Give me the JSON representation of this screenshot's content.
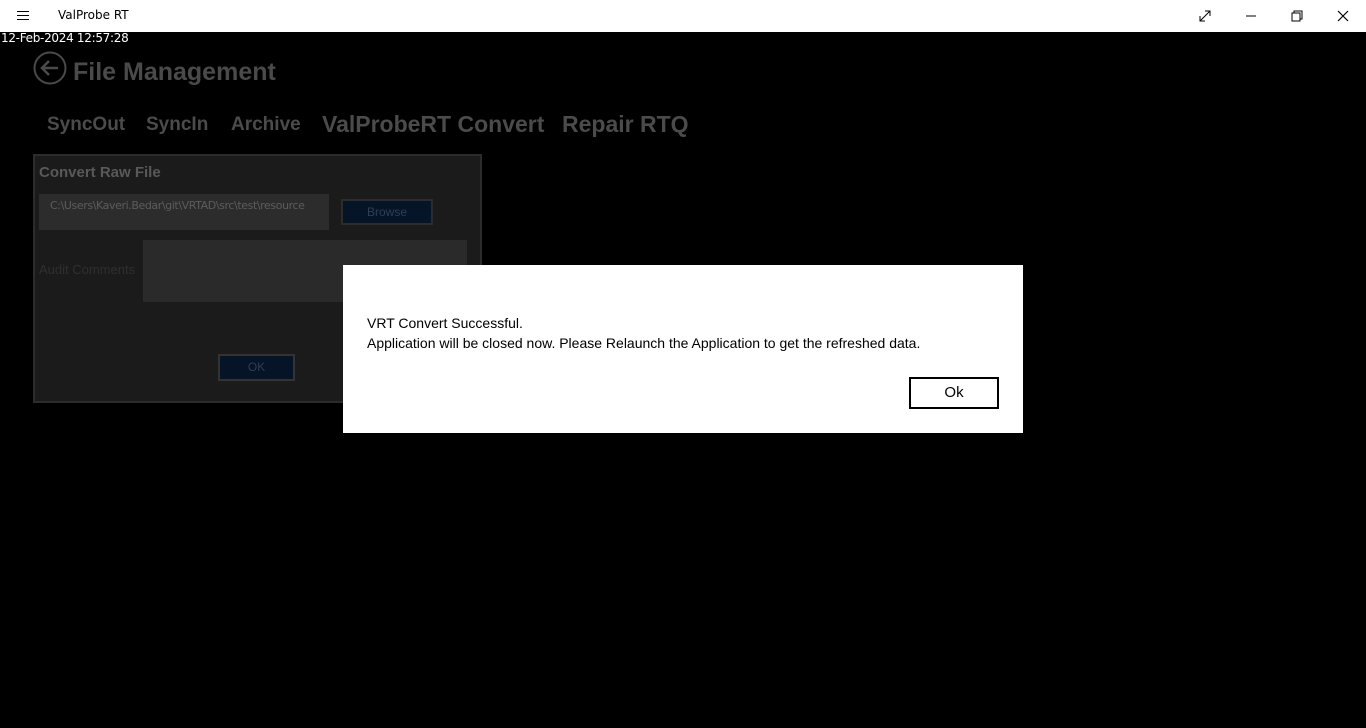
{
  "window": {
    "title": "ValProbe RT",
    "controls": [
      "expand-icon",
      "minimize-icon",
      "restore-icon",
      "close-icon"
    ]
  },
  "timestamp": "12-Feb-2024 12:57:28",
  "page": {
    "title": "File Management",
    "tabs": [
      {
        "label": "SyncOut"
      },
      {
        "label": "SyncIn"
      },
      {
        "label": "Archive"
      },
      {
        "label": "ValProbeRT Convert"
      },
      {
        "label": "Repair RTQ"
      }
    ]
  },
  "convert_panel": {
    "title": "Convert Raw File",
    "file_path": "C:\\Users\\Kaveri.Bedar\\git\\VRTAD\\src\\test\\resource",
    "browse_label": "Browse",
    "audit_label": "Audit Comments",
    "ok_label": "OK"
  },
  "dialog": {
    "line1": "VRT Convert Successful.",
    "line2": "Application will be closed now. Please Relaunch the Application to get the refreshed data.",
    "ok_label": "Ok"
  },
  "colors": {
    "background": "#000000",
    "titlebar": "#ffffff",
    "dialog": "#ffffff"
  }
}
